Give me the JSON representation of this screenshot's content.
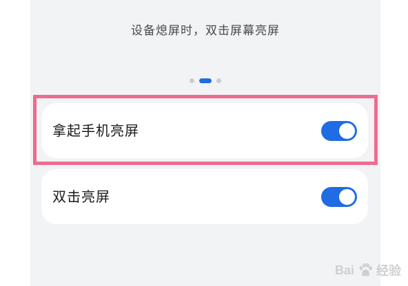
{
  "settings": {
    "caption": "设备熄屏时，双击屏幕亮屏",
    "pager": {
      "count": 3,
      "active_index": 1
    },
    "items": [
      {
        "label": "拿起手机亮屏",
        "enabled": true,
        "highlighted": true
      },
      {
        "label": "双击亮屏",
        "enabled": true,
        "highlighted": false
      }
    ]
  },
  "watermark": {
    "text_left": "Bai",
    "text_right": "经验"
  },
  "colors": {
    "accent": "#1f6ce3",
    "highlight_border": "#ee6b8f",
    "screen_bg": "#f1f3f5"
  }
}
